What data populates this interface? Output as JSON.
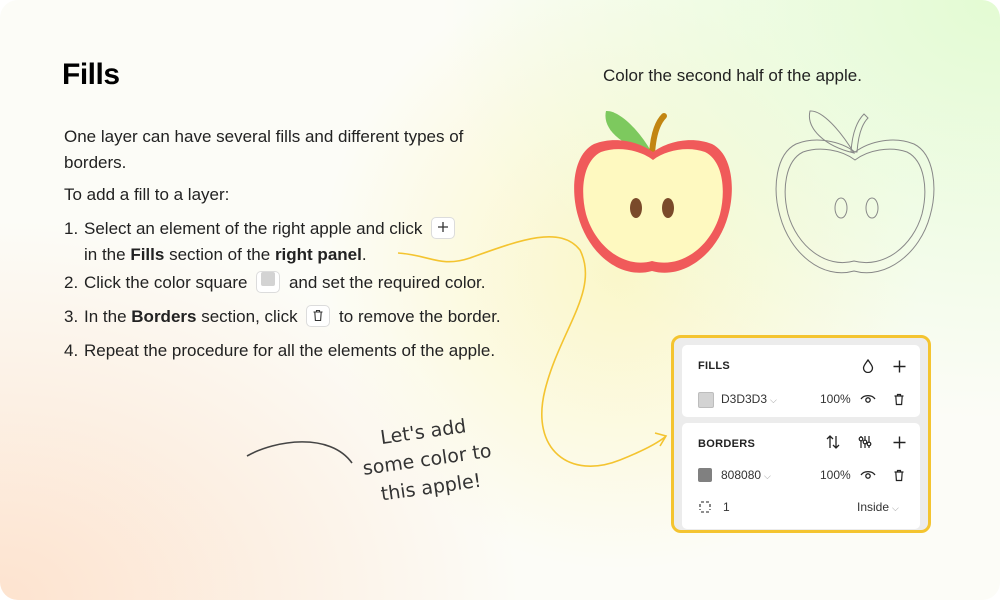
{
  "title": "Fills",
  "intro": "One layer can have several fills and different types of borders.",
  "howto": "To add a fill to a layer:",
  "steps": {
    "s1": {
      "num": "1.",
      "a": "Select an element of the right apple and click",
      "b": "in the",
      "c": "Fills",
      "d": "section of the",
      "e": "right panel",
      "f": "."
    },
    "s2": {
      "num": "2.",
      "a": "Click the color square",
      "b": "and set the required color."
    },
    "s3": {
      "num": "3.",
      "a": "In the",
      "b": "Borders",
      "c": "section, click",
      "d": "to remove the border."
    },
    "s4": {
      "num": "4.",
      "a": "Repeat the procedure for all the elements of the apple."
    }
  },
  "apple_caption": "Color the second half of the apple.",
  "note": "Let's add some color to this apple!",
  "panel": {
    "fills": {
      "heading": "FILLS",
      "hex": "D3D3D3",
      "opacity": "100%",
      "swatch": "#d3d3d3"
    },
    "borders": {
      "heading": "BORDERS",
      "hex": "808080",
      "opacity": "100%",
      "swatch": "#808080",
      "width": "1",
      "position": "Inside"
    }
  },
  "colors": {
    "highlight": "#f4c430",
    "apple_red": "#f05a5a",
    "apple_flesh": "#fef9c0",
    "leaf": "#7dc95e",
    "stem": "#c28512",
    "seed": "#7a4a2a"
  }
}
